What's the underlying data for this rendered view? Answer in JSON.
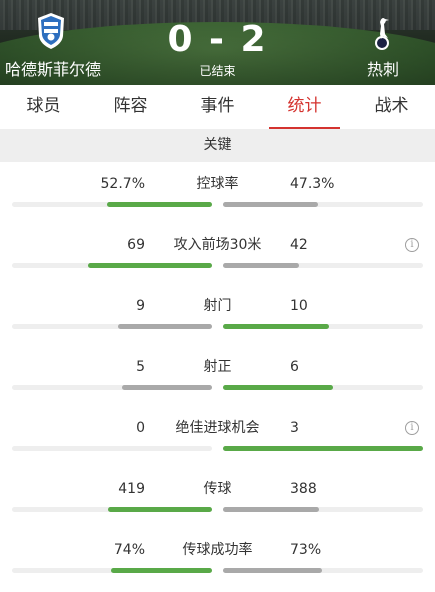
{
  "match": {
    "home_team": "哈德斯菲尔德",
    "away_team": "热刺",
    "score": "0 - 2",
    "status": "已结束"
  },
  "tabs": [
    {
      "label": "球员",
      "active": false
    },
    {
      "label": "阵容",
      "active": false
    },
    {
      "label": "事件",
      "active": false
    },
    {
      "label": "统计",
      "active": true
    },
    {
      "label": "战术",
      "active": false
    }
  ],
  "section_title": "关键",
  "colors": {
    "accent": "#d4332f",
    "bar_win": "#59a948",
    "bar_lose": "#a9a9a9",
    "track": "#eeeeee"
  },
  "stats": [
    {
      "label": "控球率",
      "home": "52.7%",
      "away": "47.3%",
      "home_share": 0.527,
      "away_share": 0.473,
      "info": false
    },
    {
      "label": "攻入前场30米",
      "home": "69",
      "away": "42",
      "home_share": 0.62,
      "away_share": 0.38,
      "info": true
    },
    {
      "label": "射门",
      "home": "9",
      "away": "10",
      "home_share": 0.47,
      "away_share": 0.53,
      "info": false
    },
    {
      "label": "射正",
      "home": "5",
      "away": "6",
      "home_share": 0.45,
      "away_share": 0.55,
      "info": false
    },
    {
      "label": "绝佳进球机会",
      "home": "0",
      "away": "3",
      "home_share": 0.0,
      "away_share": 1.0,
      "info": true
    },
    {
      "label": "传球",
      "home": "419",
      "away": "388",
      "home_share": 0.52,
      "away_share": 0.48,
      "info": false
    },
    {
      "label": "传球成功率",
      "home": "74%",
      "away": "73%",
      "home_share": 0.503,
      "away_share": 0.497,
      "info": false
    }
  ]
}
